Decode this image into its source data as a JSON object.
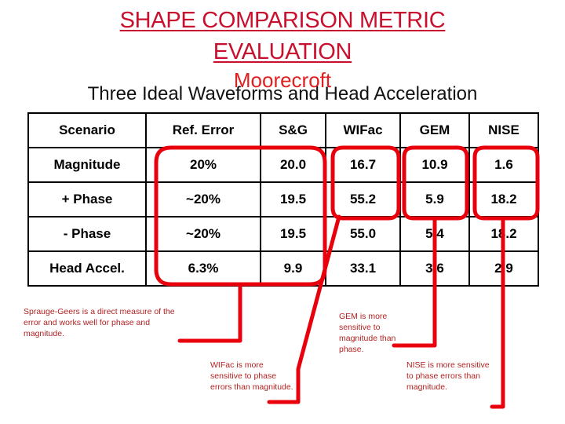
{
  "title": {
    "line1": "SHAPE COMPARISON METRIC",
    "line2": "EVALUATION",
    "author": "Moorecroft",
    "subtitle": "Three Ideal Waveforms and Head Acceleration"
  },
  "colors": {
    "title_red": "#C8102E",
    "callout_red": "#E8000D",
    "note_red": "#B22222",
    "table_border": "#000000"
  },
  "table": {
    "headers": [
      "Scenario",
      "Ref. Error",
      "S&G",
      "WIFac",
      "GEM",
      "NISE"
    ],
    "rows": [
      {
        "scenario": "Magnitude",
        "ref_error": "20%",
        "sg": "20.0",
        "wifac": "16.7",
        "gem": "10.9",
        "nise": "1.6"
      },
      {
        "scenario": "+ Phase",
        "ref_error": "~20%",
        "sg": "19.5",
        "wifac": "55.2",
        "gem": "5.9",
        "nise": "18.2"
      },
      {
        "scenario": "- Phase",
        "ref_error": "~20%",
        "sg": "19.5",
        "wifac": "55.0",
        "gem": "5.4",
        "nise": "18.2"
      },
      {
        "scenario": "Head Accel.",
        "ref_error": "6.3%",
        "sg": "9.9",
        "wifac": "33.1",
        "gem": "3.6",
        "nise": "2.9"
      }
    ]
  },
  "notes": {
    "sg": "Sprauge-Geers is a direct measure of the error and works well for phase and magnitude.",
    "wifac": "WIFac is more sensitive to phase errors than magnitude.",
    "gem": "GEM is more sensitive to magnitude than phase.",
    "nise": "NISE is more sensitive to phase errors than magnitude."
  }
}
